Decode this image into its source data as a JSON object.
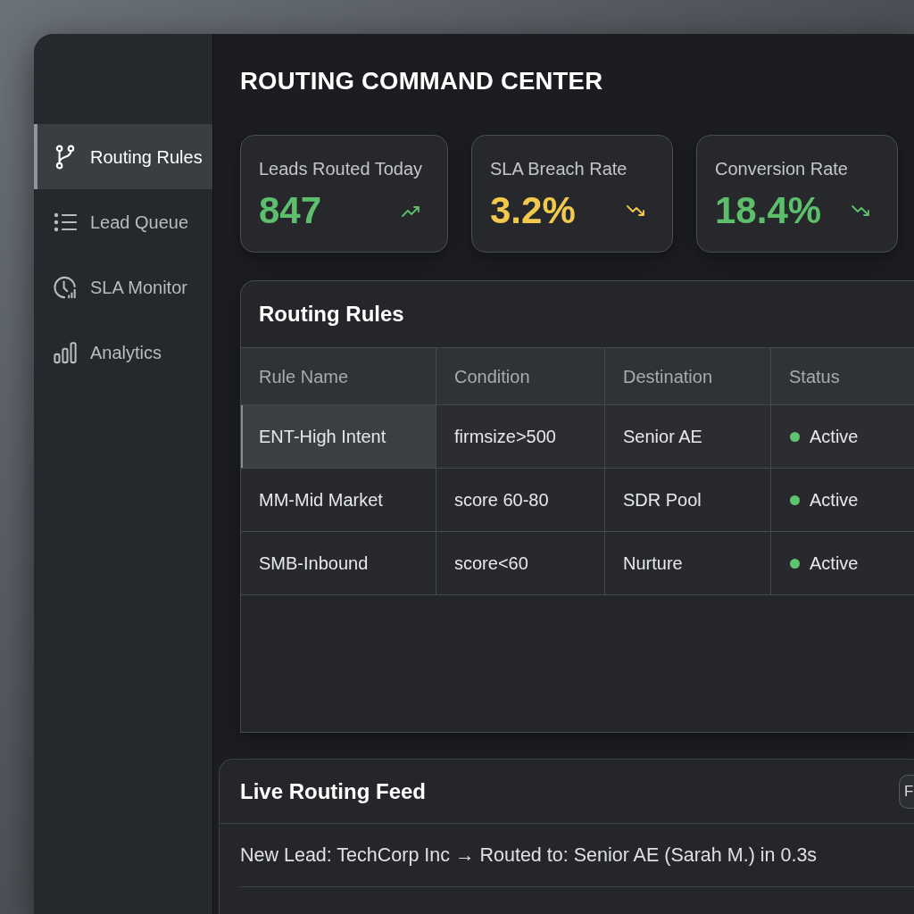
{
  "sidebar": {
    "items": [
      {
        "label": "Routing Rules",
        "selected": true
      },
      {
        "label": "Lead Queue",
        "selected": false
      },
      {
        "label": "SLA Monitor",
        "selected": false
      },
      {
        "label": "Analytics",
        "selected": false
      }
    ]
  },
  "header": {
    "title": "ROUTING COMMAND CENTER"
  },
  "stats": [
    {
      "label": "Leads Routed Today",
      "value": "847",
      "color": "#5dbf6c",
      "kind": "rising"
    },
    {
      "label": "SLA Breach Rate",
      "value": "3.2%",
      "color": "#f2c94c",
      "kind": "falling"
    },
    {
      "label": "Conversion Rate",
      "value": "18.4%",
      "color": "#5dbf6c",
      "kind": "falling"
    }
  ],
  "rules_panel": {
    "title": "Routing Rules",
    "table": {
      "columns": [
        "Rule Name",
        "Condition",
        "Destination",
        "Status"
      ],
      "rows": [
        {
          "selected": true,
          "cells": [
            "ENT-High Intent",
            "firmsize>500",
            "Senior AE"
          ],
          "status": {
            "label": "Active",
            "color": "#5ec46e"
          }
        },
        {
          "selected": false,
          "cells": [
            "MM-Mid Market",
            "score 60-80",
            "SDR Pool"
          ],
          "status": {
            "label": "Active",
            "color": "#5ec46e"
          }
        },
        {
          "selected": false,
          "cells": [
            "SMB-Inbound",
            "score<60",
            "Nurture"
          ],
          "status": {
            "label": "Active",
            "color": "#5ec46e"
          }
        }
      ]
    }
  },
  "feed_panel": {
    "title": "Live Routing Feed",
    "button": "F",
    "entries": [
      "New Lead: TechCorp Inc → Routed to: Senior AE (Sarah M.) in 0.3s"
    ]
  }
}
